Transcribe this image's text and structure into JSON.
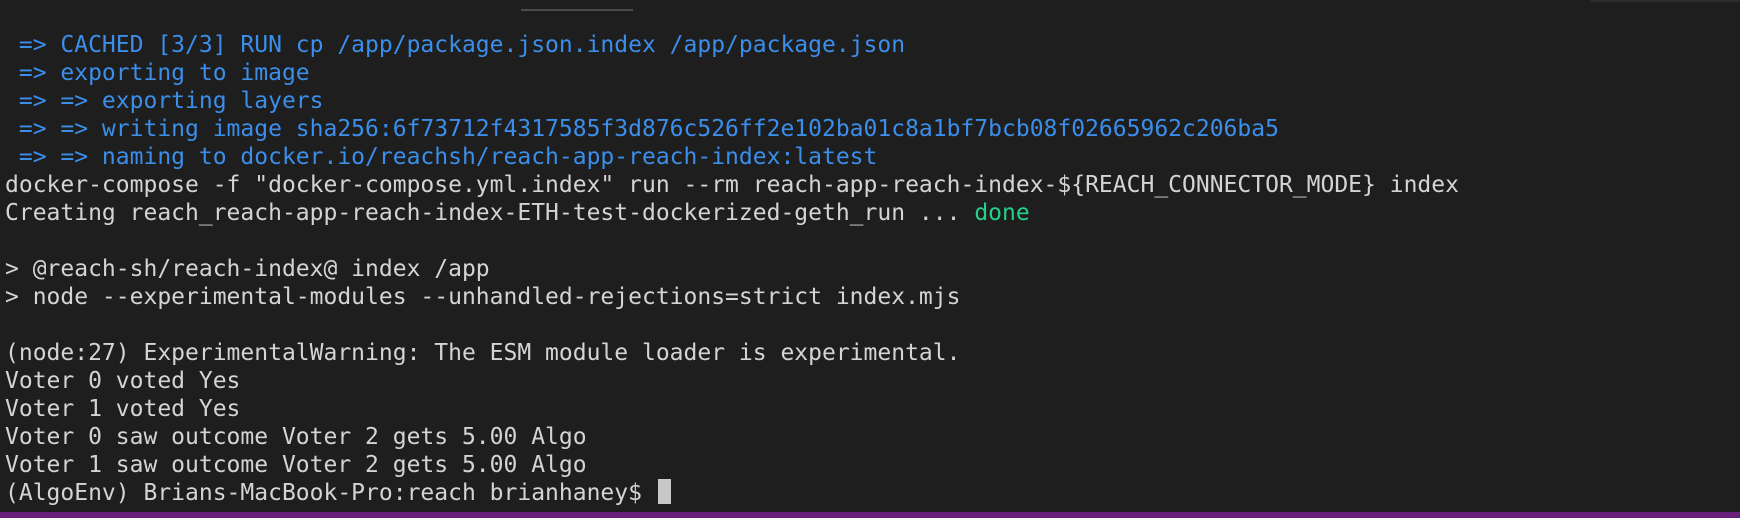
{
  "terminal": {
    "lines": [
      " => CACHED [3/3] RUN cp /app/package.json.index /app/package.json",
      " => exporting to image",
      " => => exporting layers",
      " => => writing image sha256:6f73712f4317585f3d876c526ff2e102ba01c8a1bf7bcb08f02665962c206ba5",
      " => => naming to docker.io/reachsh/reach-app-reach-index:latest",
      "docker-compose -f \"docker-compose.yml.index\" run --rm reach-app-reach-index-${REACH_CONNECTOR_MODE} index",
      "Creating reach_reach-app-reach-index-ETH-test-dockerized-geth_run ... ",
      "done",
      "",
      "> @reach-sh/reach-index@ index /app",
      "> node --experimental-modules --unhandled-rejections=strict index.mjs",
      "",
      "(node:27) ExperimentalWarning: The ESM module loader is experimental.",
      "Voter 0 voted Yes",
      "Voter 1 voted Yes",
      "Voter 0 saw outcome Voter 2 gets 5.00 Algo",
      "Voter 1 saw outcome Voter 2 gets 5.00 Algo",
      "(AlgoEnv) Brians-MacBook-Pro:reach brianhaney$ "
    ]
  },
  "colors": {
    "background": "#1e1e1e",
    "text": "#d4d4d4",
    "build_output": "#3b8eea",
    "success": "#23d18b",
    "status_bar": "#68217a"
  }
}
